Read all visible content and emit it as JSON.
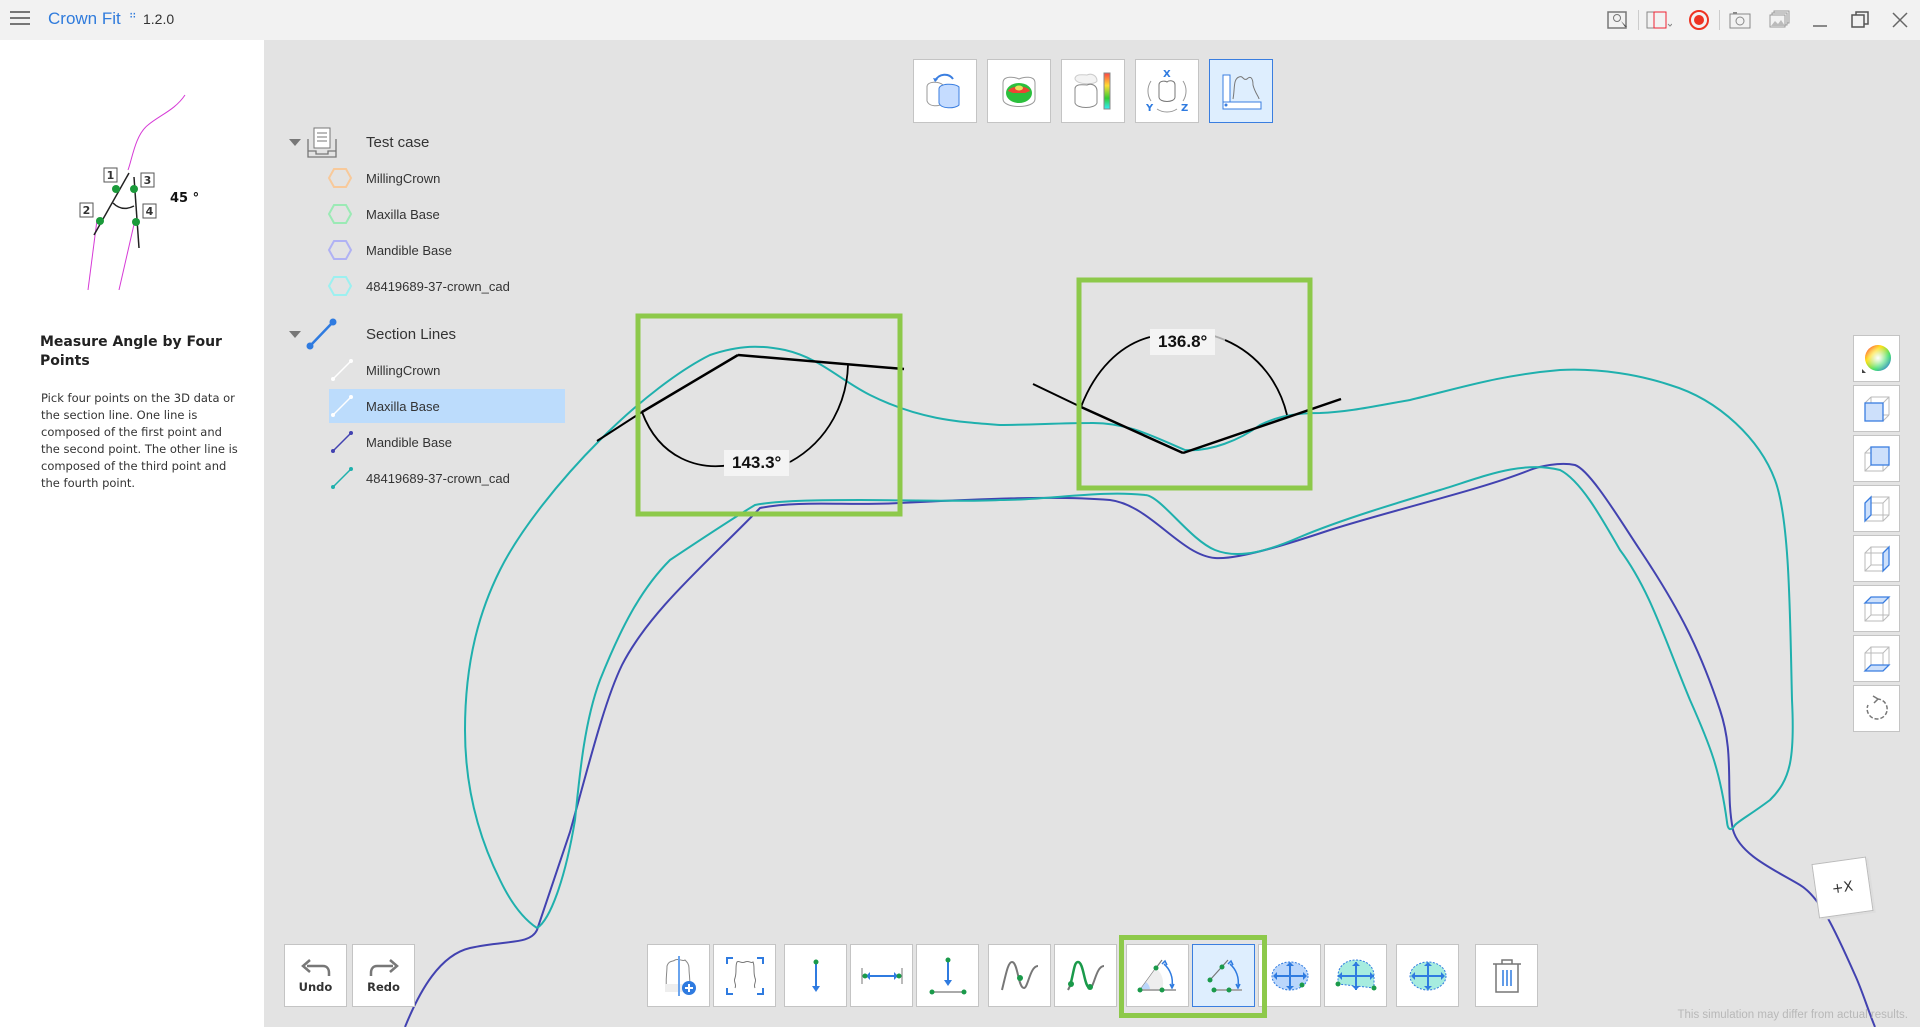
{
  "app": {
    "title": "Crown Fit",
    "badge": "∷",
    "version": "1.2.0"
  },
  "titlebar_icons": [
    "help-tips-icon",
    "screen-record-area-icon",
    "record-icon",
    "screenshot-camera-icon",
    "gallery-icon",
    "minimize-icon",
    "restore-icon",
    "close-icon"
  ],
  "help": {
    "figure_angle_label": "45 °",
    "figure_point_labels": [
      "1",
      "2",
      "3",
      "4"
    ],
    "title": "Measure Angle by Four Points",
    "description": "Pick four points on the 3D data or the section line. One line is composed of the first point and the second point. The other line is composed of the third point and the fourth point."
  },
  "tree": {
    "groups": [
      {
        "label": "Test case",
        "icon": "case-tray-icon",
        "expanded": true,
        "items": [
          {
            "label": "MillingCrown",
            "color": "#f8c99a"
          },
          {
            "label": "Maxilla Base",
            "color": "#9beab5"
          },
          {
            "label": "Mandible Base",
            "color": "#b0b2f4"
          },
          {
            "label": "48419689-37-crown_cad",
            "color": "#9cf0f0"
          }
        ]
      },
      {
        "label": "Section Lines",
        "icon": "section-line-icon",
        "expanded": true,
        "items": [
          {
            "label": "MillingCrown",
            "color": "#ffffff",
            "selected": false
          },
          {
            "label": "Maxilla Base",
            "color": "#ffffff",
            "selected": true
          },
          {
            "label": "Mandible Base",
            "color": "#4242b0",
            "selected": false
          },
          {
            "label": "48419689-37-crown_cad",
            "color": "#1fb0ad",
            "selected": false
          }
        ]
      }
    ]
  },
  "view_toolbar": [
    {
      "name": "flip-view",
      "active": false
    },
    {
      "name": "occlusion-map",
      "active": false
    },
    {
      "name": "color-scale",
      "active": false
    },
    {
      "name": "axis-rotate",
      "active": false
    },
    {
      "name": "measure-section",
      "active": true
    }
  ],
  "right_toolbar": [
    "color-wheel",
    "view-front",
    "view-back",
    "view-left",
    "view-right",
    "view-top",
    "view-bottom",
    "reset-view"
  ],
  "measurements": [
    {
      "label": "143.3°",
      "value_deg": 143.3
    },
    {
      "label": "136.8°",
      "value_deg": 136.8
    }
  ],
  "section_colors": {
    "crown_cad": "#1fb0ad",
    "mandible": "#4242b0",
    "measure": "#000000",
    "highlight": "#8dc94a"
  },
  "bottom": {
    "undo_label": "Undo",
    "redo_label": "Redo",
    "tools": [
      {
        "name": "add-section",
        "active": false
      },
      {
        "name": "fit-section",
        "active": false
      },
      {
        "name": "vertical-distance",
        "active": false
      },
      {
        "name": "horizontal-distance",
        "active": false
      },
      {
        "name": "point-to-line-distance",
        "active": false
      },
      {
        "name": "curve-point",
        "active": false
      },
      {
        "name": "curve-length",
        "active": false
      },
      {
        "name": "angle-three-points",
        "active": false
      },
      {
        "name": "angle-four-points",
        "active": true
      },
      {
        "name": "area-ellipse",
        "active": false
      },
      {
        "name": "area-section",
        "active": false
      },
      {
        "name": "area-fill",
        "active": false
      },
      {
        "name": "delete",
        "active": false
      }
    ]
  },
  "orientation_cube_label": "+X",
  "disclaimer": "This simulation may differ from actual results."
}
